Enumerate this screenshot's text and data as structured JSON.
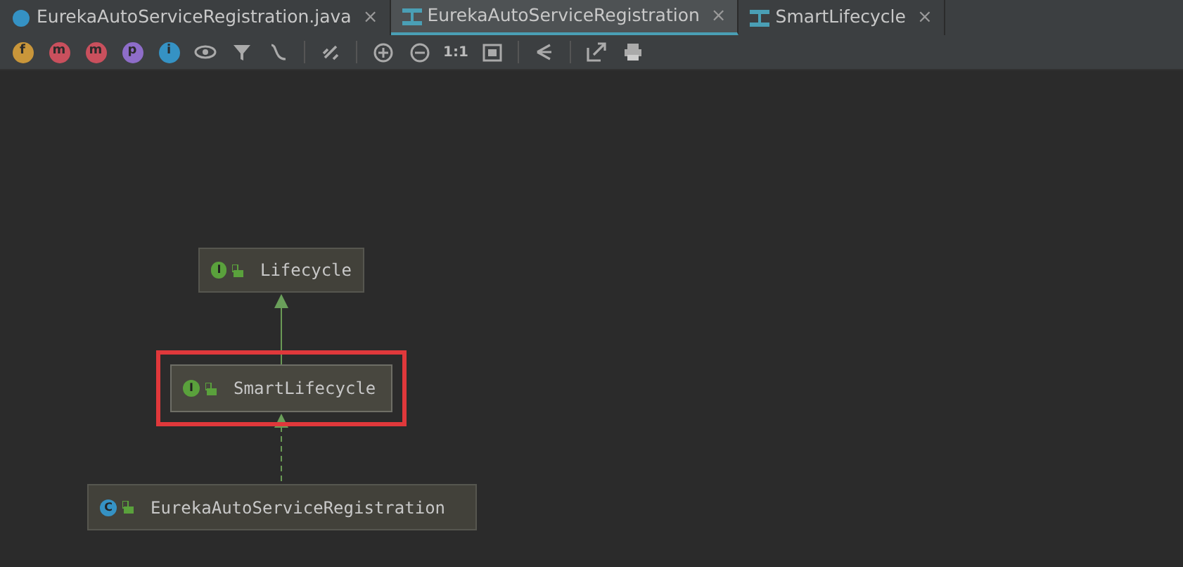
{
  "tabs": [
    {
      "label": "EurekaAutoServiceRegistration.java",
      "kind": "class",
      "selected": false,
      "close": "×"
    },
    {
      "label": "EurekaAutoServiceRegistration",
      "kind": "diagram",
      "selected": true,
      "close": "×"
    },
    {
      "label": "SmartLifecycle",
      "kind": "diagram",
      "selected": false,
      "close": "×"
    }
  ],
  "toolbar": {
    "filters": [
      {
        "glyph": "f",
        "color": "#c9963a"
      },
      {
        "glyph": "m",
        "color": "#c9505d"
      },
      {
        "glyph": "m",
        "color": "#c9505d"
      },
      {
        "glyph": "p",
        "color": "#8e6dc9"
      },
      {
        "glyph": "i",
        "color": "#3592c4"
      }
    ],
    "zoom_reset": "1:1"
  },
  "diagram": {
    "nodes": [
      {
        "name": "Lifecycle",
        "badge": "I",
        "kind": "interface",
        "selected": false
      },
      {
        "name": "SmartLifecycle",
        "badge": "I",
        "kind": "interface",
        "selected": true
      },
      {
        "name": "EurekaAutoServiceRegistration",
        "badge": "C",
        "kind": "class",
        "selected": false
      }
    ],
    "edges": [
      {
        "kind": "extends"
      },
      {
        "kind": "implements"
      }
    ]
  }
}
